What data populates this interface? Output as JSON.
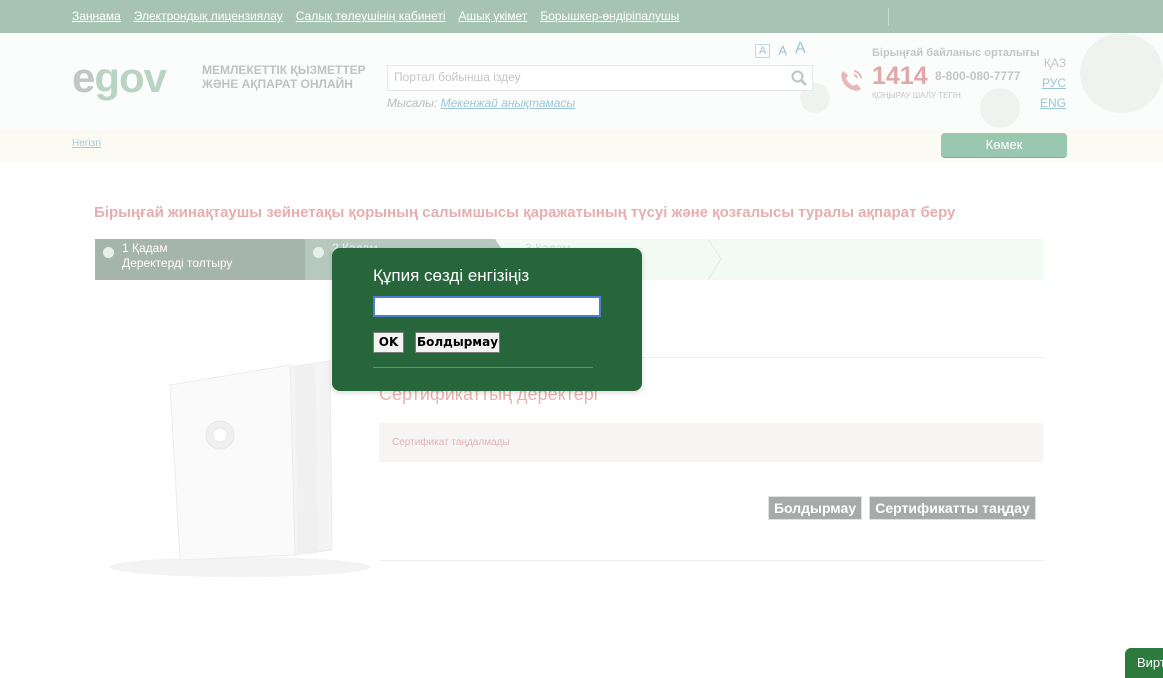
{
  "topnav": {
    "links": [
      "Заңнама",
      "Электрондық лицензиялау",
      "Салық төлеушінің кабинеті",
      "Ашық үкімет",
      "Борышкер-өндіріпалушы"
    ]
  },
  "header": {
    "logo_e": "e",
    "logo_gov": "gov",
    "tagline_line1": "МЕМЛЕКЕТТІК ҚЫЗМЕТТЕР",
    "tagline_line2": "ЖӘНЕ АҚПАРАТ ОНЛАЙН",
    "font_sizes": [
      "A",
      "A",
      "A"
    ],
    "search_placeholder": "Портал бойынша іздеу",
    "example_prefix": "Мысалы:",
    "example_link": "Мекенжай анықтамасы",
    "contact_title": "Бірыңғай байланыс орталығы",
    "contact_number": "1414",
    "contact_phone": "8-800-080-7777",
    "contact_call": "ҚОҢЫРАУ ШАЛУ ТЕГІН",
    "languages": {
      "current": "ҚАЗ",
      "ru": "РУС",
      "en": "ENG"
    }
  },
  "crumbbar": {
    "home": "Негізгі",
    "help": "Көмек"
  },
  "main": {
    "page_title": "Бірыңғай жинақтаушы зейнетақы қорының салымшысы қаражатының түсуі және қозғалысы туралы ақпарат беру",
    "steps": [
      {
        "num": "1 Қадам",
        "label": "Деректерді толтыру"
      },
      {
        "num": "2 Қадам",
        "label": ""
      },
      {
        "num": "3 Қадам",
        "label": ""
      }
    ],
    "cert_title": "Сертификаттың деректері",
    "cert_status": "Сертификат таңдалмады",
    "cancel_button": "Болдырмау",
    "select_cert_button": "Сертификатты таңдау"
  },
  "modal": {
    "title": "Құпия сөзді енгізіңіз",
    "ok": "OK",
    "cancel": "Болдырмау"
  },
  "virtual_tab": "Вирт",
  "colors": {
    "modal_bg": "#27653a",
    "accent_green": "#9ac7b0",
    "title_pink": "#e7aeb0"
  }
}
